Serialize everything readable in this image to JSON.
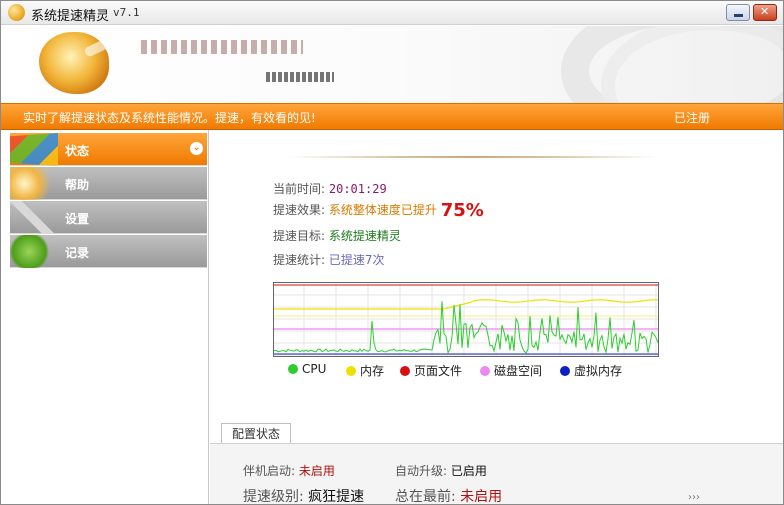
{
  "window": {
    "title": "系统提速精灵",
    "version": "v7.1"
  },
  "infobar": {
    "message": "实时了解提速状态及系统性能情况。提速，有效看的见!",
    "registration": "已注册"
  },
  "sidebar": {
    "items": [
      {
        "label": "状态",
        "icon": "windows-logo-icon",
        "active": true
      },
      {
        "label": "帮助",
        "icon": "help-icon",
        "active": false
      },
      {
        "label": "设置",
        "icon": "wrench-icon",
        "active": false
      },
      {
        "label": "记录",
        "icon": "log-icon",
        "active": false
      }
    ]
  },
  "status": {
    "time_label": "当前时间:",
    "time_value": "20:01:29",
    "effect_label": "提速效果:",
    "effect_value": "系统整体速度已提升",
    "effect_percent": "75%",
    "target_label": "提速目标:",
    "target_value": "系统提速精灵",
    "stats_label": "提速统计:",
    "stats_value": "已提速7次"
  },
  "colors": {
    "accent": "#f07a00",
    "cpu": "#2ecc2e",
    "memory": "#f0e000",
    "page_file": "#d41010",
    "disk_space": "#ee88ee",
    "virtual_memory": "#1020c0"
  },
  "legend": [
    {
      "label": "CPU",
      "color": "#2ecc2e"
    },
    {
      "label": "内存",
      "color": "#f0e000"
    },
    {
      "label": "页面文件",
      "color": "#d41010"
    },
    {
      "label": "磁盘空间",
      "color": "#ee88ee"
    },
    {
      "label": "虚拟内存",
      "color": "#1020c0"
    }
  ],
  "config": {
    "tab_label": "配置状态",
    "boot_label": "伴机启动:",
    "boot_value": "未启用",
    "update_label": "自动升级:",
    "update_value": "已启用",
    "level_label": "提速级别:",
    "level_value": "疯狂提速",
    "other_label": "总在最前:",
    "other_value": "未启用"
  }
}
